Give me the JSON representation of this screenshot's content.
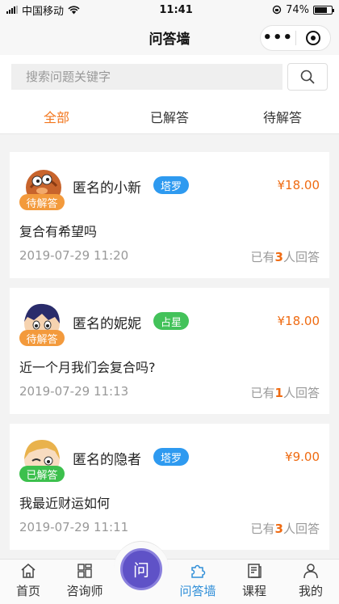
{
  "status_bar": {
    "carrier": "中国移动",
    "time": "11:41",
    "battery_text": "74%",
    "battery_level": 0.74
  },
  "nav": {
    "title": "问答墙"
  },
  "search": {
    "placeholder": "搜索问题关键字"
  },
  "tabs": [
    {
      "label": "全部",
      "active": true
    },
    {
      "label": "已解答",
      "active": false
    },
    {
      "label": "待解答",
      "active": false
    }
  ],
  "posts": [
    {
      "user": "匿名的小新",
      "category": "塔罗",
      "category_color": "#2e9af0",
      "price": "¥18.00",
      "status": "待解答",
      "status_color": "#f39a3c",
      "question": "复合有希望吗",
      "time": "2019-07-29 11:20",
      "answers_prefix": "已有",
      "answers_count": "3",
      "answers_suffix": "人回答"
    },
    {
      "user": "匿名的妮妮",
      "category": "占星",
      "category_color": "#43c25a",
      "price": "¥18.00",
      "status": "待解答",
      "status_color": "#f39a3c",
      "question": "近一个月我们会复合吗?",
      "time": "2019-07-29 11:13",
      "answers_prefix": "已有",
      "answers_count": "1",
      "answers_suffix": "人回答"
    },
    {
      "user": "匿名的隐者",
      "category": "塔罗",
      "category_color": "#2e9af0",
      "price": "¥9.00",
      "status": "已解答",
      "status_color": "#3cc04d",
      "question": "我最近财运如何",
      "time": "2019-07-29 11:11",
      "answers_prefix": "已有",
      "answers_count": "3",
      "answers_suffix": "人回答"
    }
  ],
  "tabbar": {
    "home": "首页",
    "consultant": "咨询师",
    "center": "问",
    "qa_wall": "问答墙",
    "courses": "课程",
    "mine": "我的"
  }
}
